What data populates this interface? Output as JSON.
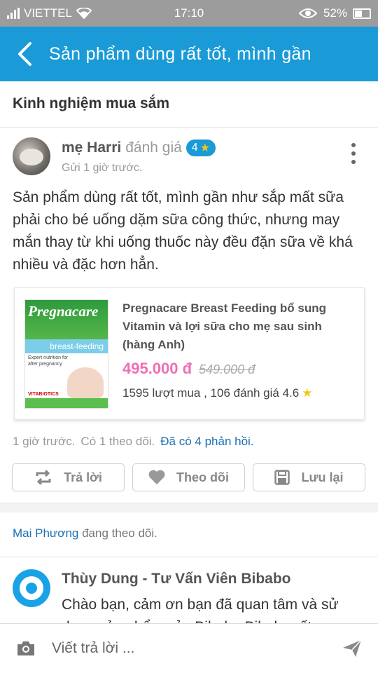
{
  "status_bar": {
    "carrier": "VIETTEL",
    "time": "17:10",
    "battery": "52%"
  },
  "app_bar": {
    "title": "Sản phẩm dùng rất tốt, mình gần"
  },
  "category": "Kinh nghiệm mua sắm",
  "post": {
    "author": "mẹ Harri",
    "verb": "đánh giá",
    "rating": "4",
    "time": "Gửi 1 giờ trước.",
    "body": "Sản phẩm dùng rất tốt, mình gần như sắp mất sữa phải cho bé uống dặm sữa công thức, nhưng may mắn thay từ khi uống thuốc này đều đặn sữa về khá nhiều và đặc hơn hẳn."
  },
  "product": {
    "name": "Pregnacare Breast Feeding bổ sung Vitamin và lợi sữa cho mẹ sau sinh (hàng Anh)",
    "price": "495.000 đ",
    "old_price": "549.000 đ",
    "stats": "1595 lượt mua , 106 đánh giá 4.6",
    "image": {
      "brand": "Pregnacare",
      "variant": "breast-feeding",
      "text": "Expert nutrition for after pregnancy",
      "maker": "VITABIOTICS"
    }
  },
  "meta": {
    "time": "1 giờ trước.",
    "followers": "Có 1 theo dõi.",
    "replies": "Đã có 4 phản hồi."
  },
  "actions": {
    "reply": "Trả lời",
    "follow": "Theo dõi",
    "save": "Lưu lại"
  },
  "follow_notice": {
    "name": "Mai Phương",
    "text": "đang theo dõi."
  },
  "reply": {
    "author": "Thùy Dung - Tư Vấn Viên Bibabo",
    "text": "Chào bạn, cảm ơn bạn đã quan tâm và sử dụng sản phẩm của Bibabo Bibabo rất"
  },
  "composer": {
    "placeholder": "Viết trả lời ..."
  },
  "colors": {
    "primary": "#1a9ad7",
    "price": "#ee6fb4",
    "link": "#1a6fb3",
    "star": "#f5c518"
  }
}
